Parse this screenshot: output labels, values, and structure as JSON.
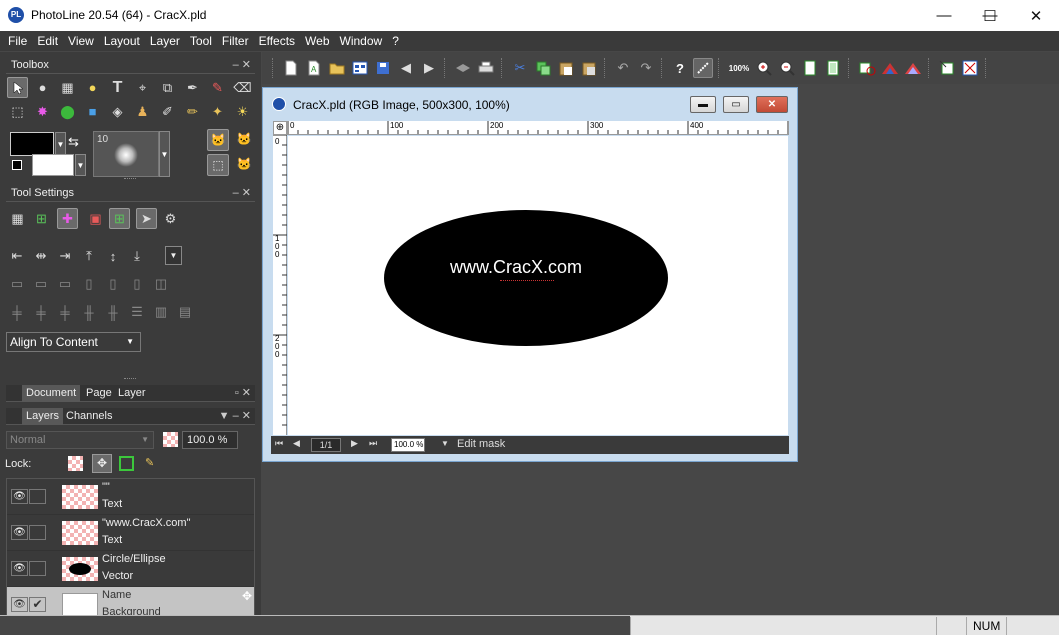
{
  "window": {
    "title": "PhotoLine 20.54 (64) - CracX.pld",
    "app_icon": "PL",
    "controls": {
      "minimize": "—",
      "maximize": "☐",
      "close": "✕"
    }
  },
  "menubar": [
    "File",
    "Edit",
    "View",
    "Layout",
    "Layer",
    "Tool",
    "Filter",
    "Effects",
    "Web",
    "Window",
    "?"
  ],
  "toolbar": {
    "zoom_100_label": "100%",
    "icons": [
      "new-document-icon",
      "new-text-icon",
      "open-folder-icon",
      "browser-icon",
      "save-icon",
      "previous-icon",
      "next-icon",
      "scan-icon",
      "print-icon",
      "cut-icon",
      "copy-icon",
      "paste-icon",
      "paste-into-icon",
      "undo-icon",
      "redo-icon",
      "help-icon",
      "draw-line-icon",
      "zoom-100-icon",
      "zoom-in-icon",
      "zoom-out-icon",
      "fit-page-icon",
      "fit-window-icon",
      "rotate-icon",
      "histogram-icon",
      "levels-icon",
      "crop-icon",
      "color-profile-icon"
    ]
  },
  "toolbox": {
    "title": "Toolbox",
    "brush_size": "10",
    "foreground_color": "#000000",
    "background_color": "#ffffff"
  },
  "tool_settings": {
    "title": "Tool Settings",
    "align_dropdown": "Align To Content"
  },
  "doc_tabs": [
    "Document",
    "Page",
    "Layer"
  ],
  "layers_panel": {
    "tabs": [
      "Layers",
      "Channels"
    ],
    "blend_mode": "Normal",
    "opacity": "100.0 %",
    "lock_label": "Lock:",
    "layers": [
      {
        "name": "\"\"",
        "type": "Text",
        "selected": false,
        "checked": false
      },
      {
        "name": "\"www.CracX.com\"",
        "type": "Text",
        "selected": false,
        "checked": false
      },
      {
        "name": "Circle/Ellipse",
        "type": "Vector",
        "selected": false,
        "checked": false
      },
      {
        "name": "Name",
        "type": "Background",
        "selected": true,
        "checked": true
      }
    ]
  },
  "document": {
    "title": "CracX.pld (RGB Image, 500x300, 100%)",
    "ruler_top_labels": [
      "0",
      "100",
      "200",
      "300",
      "400"
    ],
    "ruler_left_labels": [
      "0",
      "100",
      "200"
    ],
    "canvas_text": "www.CracX.com",
    "ellipse_color": "#000000",
    "page_indicator": "1/1",
    "zoom": "100.0 %",
    "mode": "Edit mask"
  },
  "statusbar": {
    "num": "NUM"
  }
}
